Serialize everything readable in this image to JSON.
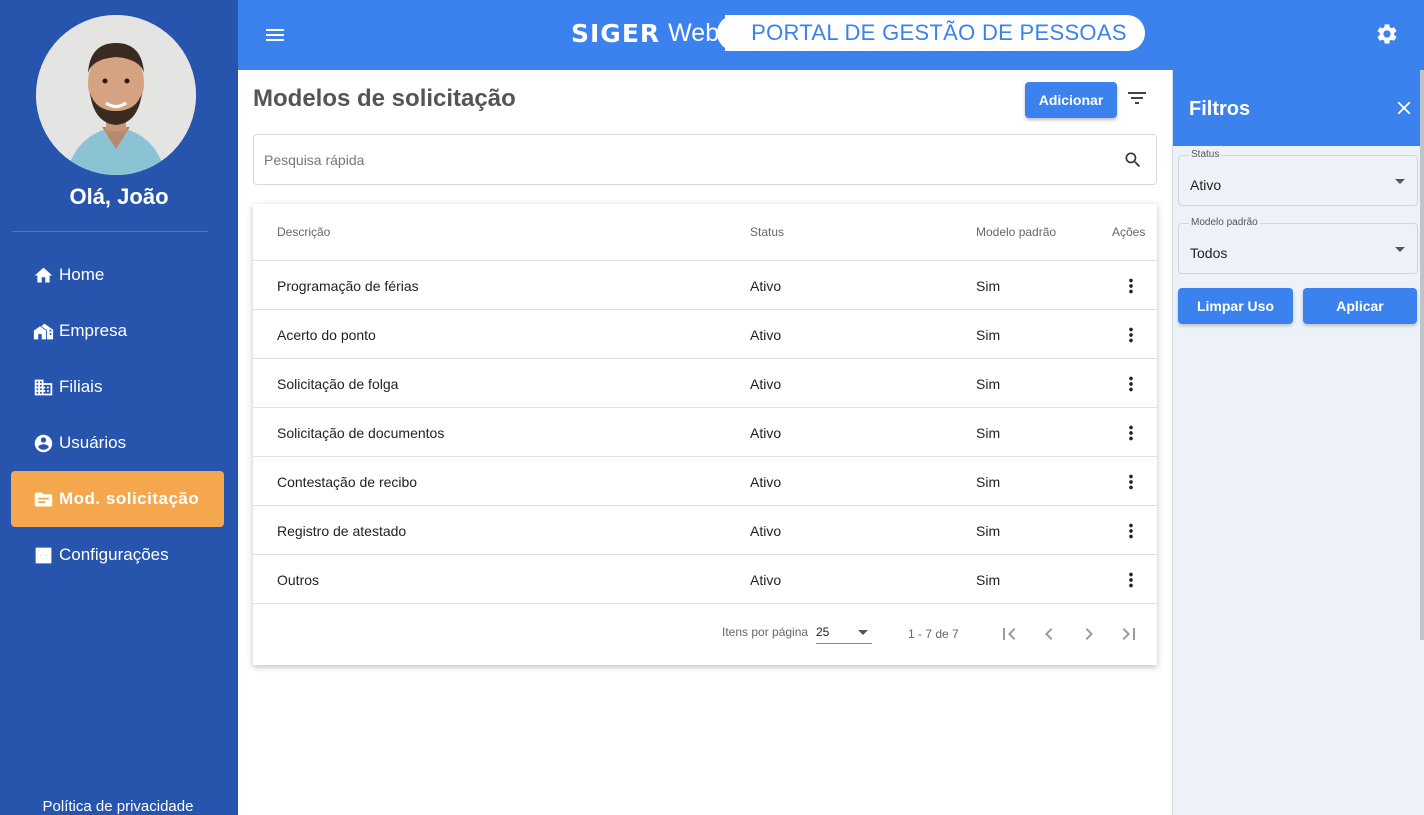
{
  "sidebar": {
    "greeting": "Olá, João",
    "items": [
      {
        "label": "Home",
        "icon": "home-icon"
      },
      {
        "label": "Empresa",
        "icon": "company-icon"
      },
      {
        "label": "Filiais",
        "icon": "building-icon"
      },
      {
        "label": "Usuários",
        "icon": "account-circle-icon"
      },
      {
        "label": "Mod. solicitação",
        "icon": "folder-icon",
        "active": true
      },
      {
        "label": "Configurações",
        "icon": "settings-box-icon"
      }
    ],
    "privacy": "Política de privacidade"
  },
  "header": {
    "brand_siger": "SIGER",
    "brand_web": "Web",
    "portal_title": "PORTAL DE GESTÃO DE PESSOAS"
  },
  "main": {
    "title": "Modelos de solicitação",
    "add_label": "Adicionar",
    "search_placeholder": "Pesquisa rápida",
    "columns": {
      "description": "Descrição",
      "status": "Status",
      "default_model": "Modelo padrão",
      "actions": "Ações"
    },
    "rows": [
      {
        "description": "Programação de férias",
        "status": "Ativo",
        "default_model": "Sim"
      },
      {
        "description": "Acerto do ponto",
        "status": "Ativo",
        "default_model": "Sim"
      },
      {
        "description": "Solicitação de folga",
        "status": "Ativo",
        "default_model": "Sim"
      },
      {
        "description": "Solicitação de documentos",
        "status": "Ativo",
        "default_model": "Sim"
      },
      {
        "description": "Contestação de recibo",
        "status": "Ativo",
        "default_model": "Sim"
      },
      {
        "description": "Registro de atestado",
        "status": "Ativo",
        "default_model": "Sim"
      },
      {
        "description": "Outros",
        "status": "Ativo",
        "default_model": "Sim"
      }
    ],
    "paginator": {
      "items_per_page_label": "Itens por página",
      "items_per_page": "25",
      "range": "1 - 7 de 7"
    }
  },
  "filters": {
    "title": "Filtros",
    "status_label": "Status",
    "status_value": "Ativo",
    "model_label": "Modelo padrão",
    "model_value": "Todos",
    "clear_label": "Limpar Uso",
    "apply_label": "Aplicar"
  },
  "colors": {
    "sidebar": "#2755ad",
    "header": "#3b82ef",
    "active_item": "#f5a74d",
    "filter_panel": "#edf2f8"
  }
}
